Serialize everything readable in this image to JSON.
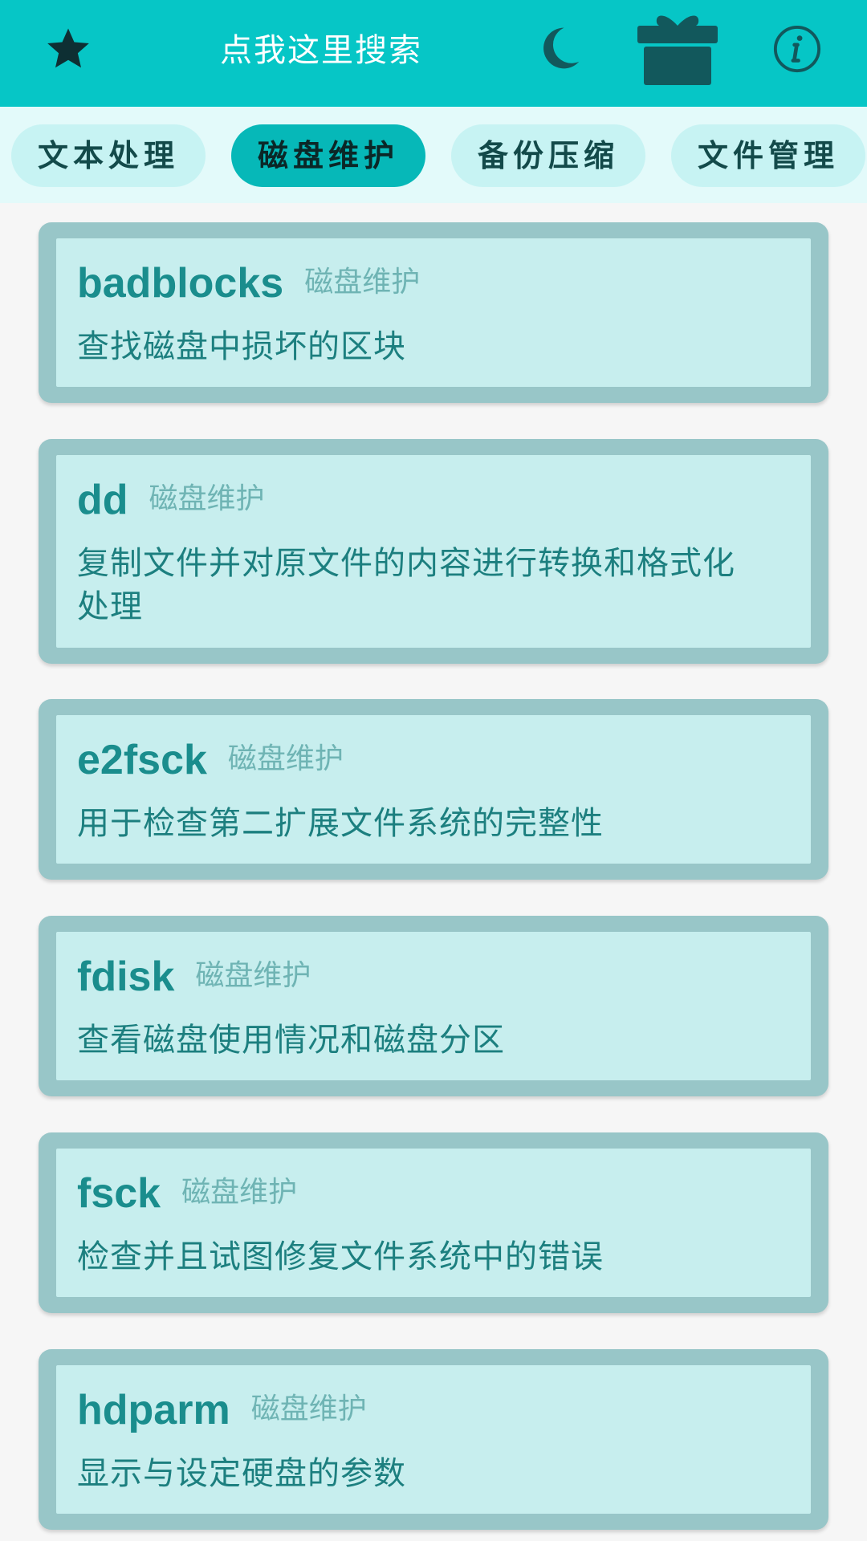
{
  "topbar": {
    "search_label": "点我这里搜索",
    "icons": [
      "star-icon",
      "moon-icon",
      "gift-icon",
      "info-icon"
    ]
  },
  "categories": [
    {
      "label": "文本处理",
      "active": false
    },
    {
      "label": "磁盘维护",
      "active": true
    },
    {
      "label": "备份压缩",
      "active": false
    },
    {
      "label": "文件管理",
      "active": false
    }
  ],
  "commands": [
    {
      "name": "badblocks",
      "tag": "磁盘维护",
      "desc": "查找磁盘中损坏的区块"
    },
    {
      "name": "dd",
      "tag": "磁盘维护",
      "desc": "复制文件并对原文件的内容进行转换和格式化处理"
    },
    {
      "name": "e2fsck",
      "tag": "磁盘维护",
      "desc": "用于检查第二扩展文件系统的完整性"
    },
    {
      "name": "fdisk",
      "tag": "磁盘维护",
      "desc": "查看磁盘使用情况和磁盘分区"
    },
    {
      "name": "fsck",
      "tag": "磁盘维护",
      "desc": "检查并且试图修复文件系统中的错误"
    },
    {
      "name": "hdparm",
      "tag": "磁盘维护",
      "desc": "显示与设定硬盘的参数"
    }
  ],
  "colors": {
    "topbar": "#06c6c6",
    "active_chip": "#06b8b8",
    "chip": "#c7f3f3",
    "card_border": "#98c6c8",
    "card_fill": "#c7eeee",
    "command_text": "#1a8d8d"
  }
}
